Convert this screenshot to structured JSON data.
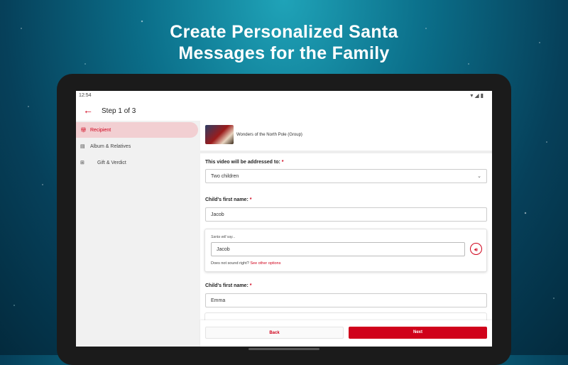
{
  "headline": {
    "line1": "Create Personalized Santa",
    "line2": "Messages for the Family"
  },
  "status_bar": {
    "time": "12:54",
    "icons": [
      "wifi-icon",
      "signal-icon",
      "battery-icon"
    ]
  },
  "app_bar": {
    "back_icon": "back-arrow-icon",
    "title": "Step 1 of 3"
  },
  "sidebar": {
    "items": [
      {
        "label": "Recipient",
        "icon": "gift-icon",
        "active": true
      },
      {
        "label": "Album & Relatives",
        "icon": "album-icon",
        "active": false
      },
      {
        "label": "Gift & Verdict",
        "icon": "gift-verdict-icon",
        "active": false
      }
    ]
  },
  "video": {
    "title": "Wonders of the North Pole (Group)"
  },
  "form": {
    "addressed_label": "This video will be addressed to:",
    "required_mark": "*",
    "addressed_value": "Two children",
    "child1_label": "Child's first name:",
    "child1_value": "Jacob",
    "santa_says": "Santa will say...",
    "santa_value": "Jacob",
    "sound_note": "Does not sound right?",
    "sound_link": "See other options",
    "child2_label": "Child's first name:",
    "child2_value": "Emma"
  },
  "buttons": {
    "back": "Back",
    "next": "Next"
  },
  "colors": {
    "accent": "#d0021b",
    "active_bg": "#f2cfd2",
    "sidebar_bg": "#f1f1f1"
  }
}
